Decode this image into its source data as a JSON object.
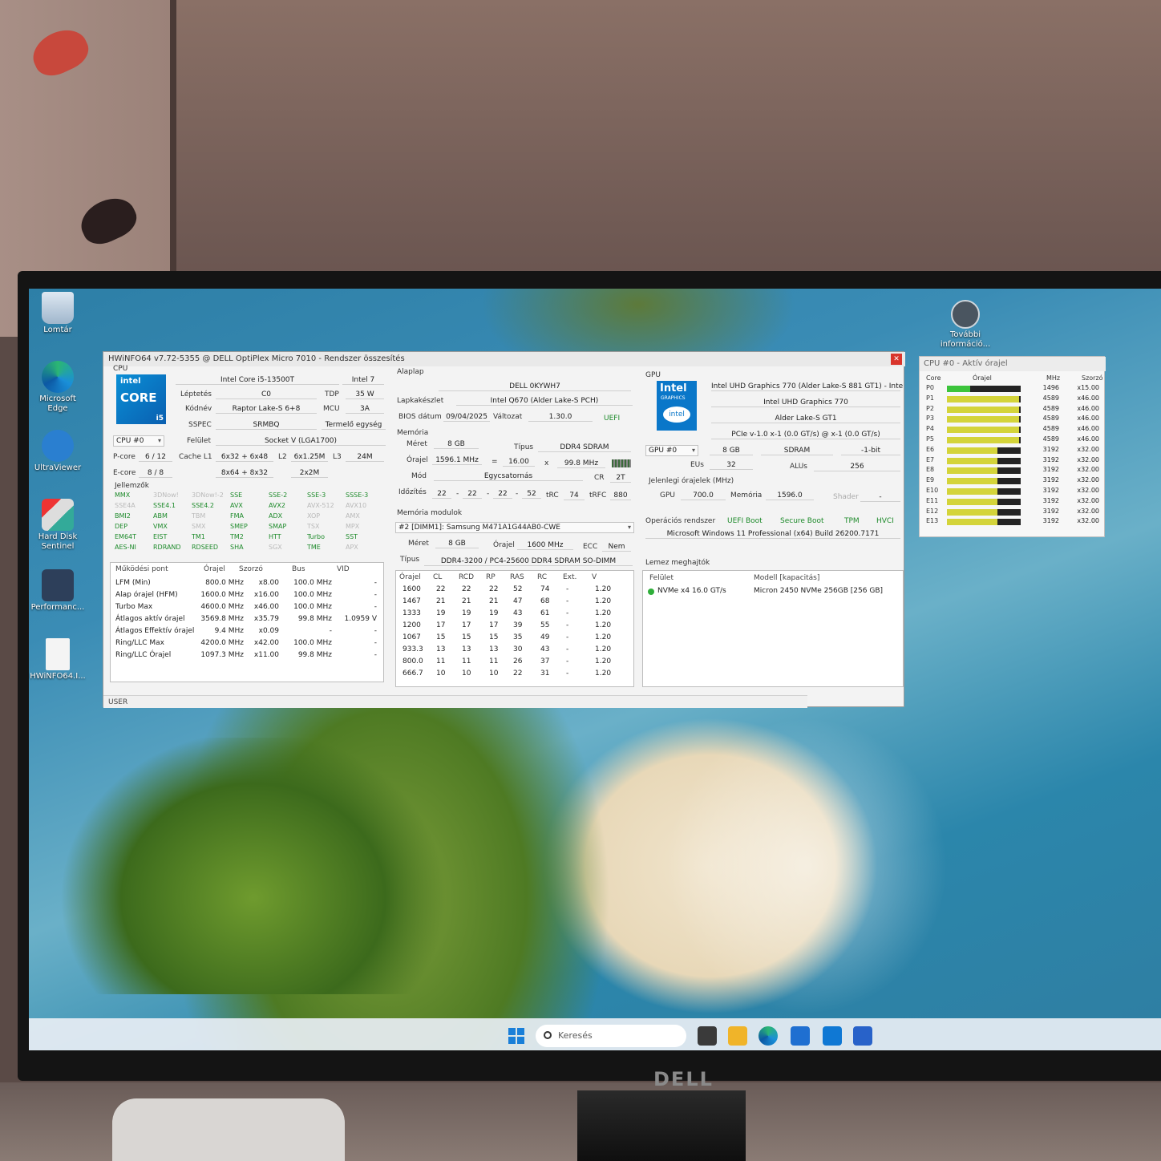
{
  "desktop": {
    "icons": [
      {
        "label": "Lomtár"
      },
      {
        "label": "Microsoft Edge"
      },
      {
        "label": "UltraViewer"
      },
      {
        "label": "Hard Disk Sentinel"
      },
      {
        "label": "Performanc..."
      },
      {
        "label": "HWiNFO64.I..."
      }
    ],
    "right_icon": {
      "label": "További információ..."
    }
  },
  "taskbar": {
    "search_placeholder": "Keresés",
    "apps": [
      "task-view-icon",
      "file-explorer-icon",
      "edge-icon",
      "store-icon",
      "outlook-icon",
      "app-grid-icon"
    ]
  },
  "hwinfo": {
    "title": "HWiNFO64 v7.72-5355 @ DELL OptiPlex Micro 7010 - Rendszer összesítés",
    "cpu": {
      "group": "CPU",
      "logo_brand": "intel",
      "logo_core": "CORE",
      "logo_gen": "i5",
      "name": "Intel Core i5-13500T",
      "brand": "Intel 7",
      "stepping_label": "Léptetés",
      "stepping": "C0",
      "tdp_label": "TDP",
      "tdp": "35 W",
      "codename_label": "Kódnév",
      "codename": "Raptor Lake-S 6+8",
      "mcu_label": "MCU",
      "mcu": "3A",
      "sspec_label": "SSPEC",
      "sspec": "SRMBQ",
      "unit": "Termelő egység",
      "selector": "CPU #0",
      "surface_label": "Felület",
      "surface": "Socket V (LGA1700)",
      "pcore_label": "P-core",
      "pcore": "6 / 12",
      "cache_l1_label": "Cache L1",
      "pcore_l1": "6x32 + 6x48",
      "l2_label": "L2",
      "pcore_l2": "6x1.25M",
      "l3_label": "L3",
      "l3": "24M",
      "ecore_label": "E-core",
      "ecore": "8 / 8",
      "ecore_l1": "8x64 + 8x32",
      "ecore_l2": "2x2M",
      "features_label": "Jellemzők",
      "features": [
        {
          "name": "MMX",
          "on": true
        },
        {
          "name": "3DNow!",
          "on": false
        },
        {
          "name": "3DNow!-2",
          "on": false
        },
        {
          "name": "SSE",
          "on": true
        },
        {
          "name": "SSE-2",
          "on": true
        },
        {
          "name": "SSE-3",
          "on": true
        },
        {
          "name": "SSSE-3",
          "on": true
        },
        {
          "name": "SSE4A",
          "on": false
        },
        {
          "name": "SSE4.1",
          "on": true
        },
        {
          "name": "SSE4.2",
          "on": true
        },
        {
          "name": "AVX",
          "on": true
        },
        {
          "name": "AVX2",
          "on": true
        },
        {
          "name": "AVX-512",
          "on": false
        },
        {
          "name": "AVX10",
          "on": false
        },
        {
          "name": "BMI2",
          "on": true
        },
        {
          "name": "ABM",
          "on": true
        },
        {
          "name": "TBM",
          "on": false
        },
        {
          "name": "FMA",
          "on": true
        },
        {
          "name": "ADX",
          "on": true
        },
        {
          "name": "XOP",
          "on": false
        },
        {
          "name": "AMX",
          "on": false
        },
        {
          "name": "DEP",
          "on": true
        },
        {
          "name": "VMX",
          "on": true
        },
        {
          "name": "SMX",
          "on": false
        },
        {
          "name": "SMEP",
          "on": true
        },
        {
          "name": "SMAP",
          "on": true
        },
        {
          "name": "TSX",
          "on": false
        },
        {
          "name": "MPX",
          "on": false
        },
        {
          "name": "EM64T",
          "on": true
        },
        {
          "name": "EIST",
          "on": true
        },
        {
          "name": "TM1",
          "on": true
        },
        {
          "name": "TM2",
          "on": true
        },
        {
          "name": "HTT",
          "on": true
        },
        {
          "name": "Turbo",
          "on": true
        },
        {
          "name": "SST",
          "on": true
        },
        {
          "name": "AES-NI",
          "on": true
        },
        {
          "name": "RDRAND",
          "on": true
        },
        {
          "name": "RDSEED",
          "on": true
        },
        {
          "name": "SHA",
          "on": true
        },
        {
          "name": "SGX",
          "on": false
        },
        {
          "name": "TME",
          "on": true
        },
        {
          "name": "APX",
          "on": false
        }
      ],
      "op_table": {
        "headers": [
          "Működési pont",
          "Órajel",
          "Szorzó",
          "Bus",
          "VID"
        ],
        "rows": [
          [
            "LFM (Min)",
            "800.0 MHz",
            "x8.00",
            "100.0 MHz",
            "-"
          ],
          [
            "Alap órajel (HFM)",
            "1600.0 MHz",
            "x16.00",
            "100.0 MHz",
            "-"
          ],
          [
            "Turbo Max",
            "4600.0 MHz",
            "x46.00",
            "100.0 MHz",
            "-"
          ],
          [
            "Átlagos aktív órajel",
            "3569.8 MHz",
            "x35.79",
            "99.8 MHz",
            "1.0959 V"
          ],
          [
            "Átlagos Effektív órajel",
            "9.4 MHz",
            "x0.09",
            "-",
            "-"
          ],
          [
            "Ring/LLC Max",
            "4200.0 MHz",
            "x42.00",
            "100.0 MHz",
            "-"
          ],
          [
            "Ring/LLC Órajel",
            "1097.3 MHz",
            "x11.00",
            "99.8 MHz",
            "-"
          ]
        ]
      }
    },
    "board": {
      "group": "Alaplap",
      "model": "DELL 0KYWH7",
      "chipset_label": "Lapkakészlet",
      "chipset": "Intel Q670 (Alder Lake-S PCH)",
      "bios_date_label": "BIOS dátum",
      "bios_date": "09/04/2025",
      "version_label": "Változat",
      "version": "1.30.0",
      "uefi": "UEFI"
    },
    "memory": {
      "group": "Memória",
      "size_label": "Méret",
      "size": "8 GB",
      "type_label": "Típus",
      "type": "DDR4 SDRAM",
      "clock_label": "Órajel",
      "clock": "1596.1 MHz",
      "eq": "=",
      "mult": "16.00",
      "x": "x",
      "bus": "99.8 MHz",
      "mode_label": "Mód",
      "mode": "Egycsatornás",
      "cr_label": "CR",
      "cr": "2T",
      "timing_label": "Időzítés",
      "t1": "22",
      "t2": "22",
      "t3": "22",
      "t4": "52",
      "trc_label": "tRC",
      "trc": "74",
      "trfc_label": "tRFC",
      "trfc": "880",
      "dash": "-"
    },
    "modules": {
      "group": "Memória modulok",
      "selected": "#2 [DIMM1]: Samsung M471A1G44AB0-CWE",
      "size_label": "Méret",
      "size": "8 GB",
      "clock_label": "Órajel",
      "clock": "1600 MHz",
      "ecc_label": "ECC",
      "ecc": "Nem",
      "type_label": "Típus",
      "type": "DDR4-3200 / PC4-25600 DDR4 SDRAM SO-DIMM",
      "timing_table": {
        "headers": [
          "Órajel",
          "CL",
          "RCD",
          "RP",
          "RAS",
          "RC",
          "Ext.",
          "V"
        ],
        "rows": [
          [
            "1600",
            "22",
            "22",
            "22",
            "52",
            "74",
            "-",
            "1.20"
          ],
          [
            "1467",
            "21",
            "21",
            "21",
            "47",
            "68",
            "-",
            "1.20"
          ],
          [
            "1333",
            "19",
            "19",
            "19",
            "43",
            "61",
            "-",
            "1.20"
          ],
          [
            "1200",
            "17",
            "17",
            "17",
            "39",
            "55",
            "-",
            "1.20"
          ],
          [
            "1067",
            "15",
            "15",
            "15",
            "35",
            "49",
            "-",
            "1.20"
          ],
          [
            "933.3",
            "13",
            "13",
            "13",
            "30",
            "43",
            "-",
            "1.20"
          ],
          [
            "800.0",
            "11",
            "11",
            "11",
            "26",
            "37",
            "-",
            "1.20"
          ],
          [
            "666.7",
            "10",
            "10",
            "10",
            "22",
            "31",
            "-",
            "1.20"
          ]
        ]
      }
    },
    "gpu": {
      "group": "GPU",
      "logo_brand": "Intel",
      "logo_sub": "GRAPHICS",
      "logo_small": "intel",
      "name_full": "Intel UHD Graphics 770 (Alder Lake-S 881 GT1) - Inte",
      "name": "Intel UHD Graphics 770",
      "codename": "Alder Lake-S GT1",
      "pcie": "PCIe v-1.0 x-1 (0.0 GT/s) @ x-1 (0.0 GT/s)",
      "selector": "GPU #0",
      "vram": "8 GB",
      "vram_type": "SDRAM",
      "bus_width": "-1-bit",
      "eus_label": "EUs",
      "eus": "32",
      "alus_label": "ALUs",
      "alus": "256",
      "clocks_label": "Jelenlegi órajelek (MHz)",
      "gpu_label": "GPU",
      "gpu_clock": "700.0",
      "mem_label": "Memória",
      "mem_clock": "1596.0",
      "shader_label": "Shader",
      "shader_clock": "-"
    },
    "os": {
      "label": "Operációs rendszer",
      "flags": [
        {
          "name": "UEFI Boot",
          "on": true
        },
        {
          "name": "Secure Boot",
          "on": true
        },
        {
          "name": "TPM",
          "on": true
        },
        {
          "name": "HVCI",
          "on": true
        }
      ],
      "name": "Microsoft Windows 11 Professional (x64) Build 26200.7171"
    },
    "drives": {
      "group": "Lemez meghajtók",
      "headers": [
        "Felület",
        "Modell [kapacitás]"
      ],
      "rows": [
        [
          "NVMe x4 16.0 GT/s",
          "Micron 2450 NVMe 256GB [256 GB]"
        ]
      ]
    },
    "status": "USER"
  },
  "cpu_clock_window": {
    "title": "CPU #0 - Aktív órajel",
    "headers": [
      "Core",
      "Órajel",
      "MHz",
      "Szorzó"
    ],
    "rows": [
      {
        "core": "P0",
        "mhz": "1496",
        "mult": "x15.00",
        "fraction": 0.32
      },
      {
        "core": "P1",
        "mhz": "4589",
        "mult": "x46.00",
        "fraction": 0.98
      },
      {
        "core": "P2",
        "mhz": "4589",
        "mult": "x46.00",
        "fraction": 0.98
      },
      {
        "core": "P3",
        "mhz": "4589",
        "mult": "x46.00",
        "fraction": 0.98
      },
      {
        "core": "P4",
        "mhz": "4589",
        "mult": "x46.00",
        "fraction": 0.98
      },
      {
        "core": "P5",
        "mhz": "4589",
        "mult": "x46.00",
        "fraction": 0.98
      },
      {
        "core": "E6",
        "mhz": "3192",
        "mult": "x32.00",
        "fraction": 0.68
      },
      {
        "core": "E7",
        "mhz": "3192",
        "mult": "x32.00",
        "fraction": 0.68
      },
      {
        "core": "E8",
        "mhz": "3192",
        "mult": "x32.00",
        "fraction": 0.68
      },
      {
        "core": "E9",
        "mhz": "3192",
        "mult": "x32.00",
        "fraction": 0.68
      },
      {
        "core": "E10",
        "mhz": "3192",
        "mult": "x32.00",
        "fraction": 0.68
      },
      {
        "core": "E11",
        "mhz": "3192",
        "mult": "x32.00",
        "fraction": 0.68
      },
      {
        "core": "E12",
        "mhz": "3192",
        "mult": "x32.00",
        "fraction": 0.68
      },
      {
        "core": "E13",
        "mhz": "3192",
        "mult": "x32.00",
        "fraction": 0.68
      }
    ],
    "colors": {
      "low": "#3cc43c",
      "high": "#d4d43a"
    }
  },
  "monitor": {
    "brand": "DELL"
  },
  "colors": {
    "close": "#d9352c",
    "feature_on": "#1d8a2a",
    "feature_off": "#b9b9b9",
    "intel_blue": "#0068b5"
  }
}
